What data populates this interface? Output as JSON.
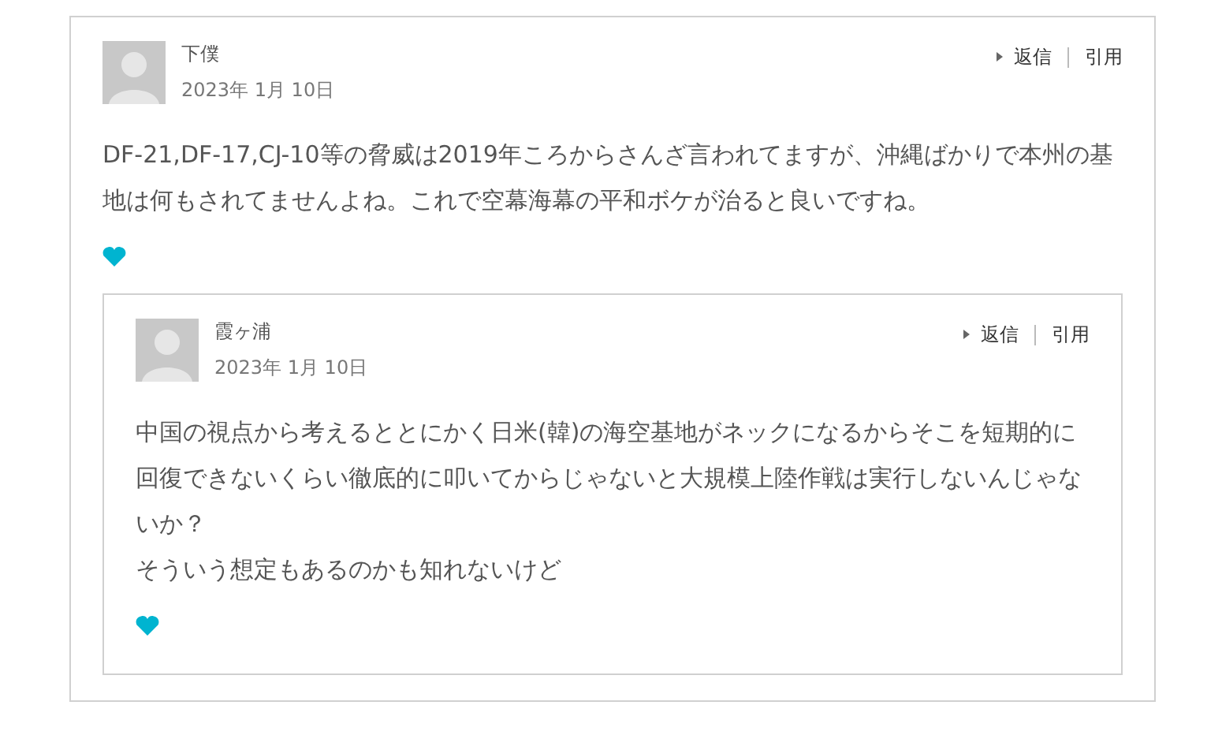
{
  "comments": [
    {
      "author": "下僕",
      "date": "2023年 1月 10日",
      "actions": [
        "返信",
        "引用"
      ],
      "body": [
        "DF-21,DF-17,CJ-10等の脅威は2019年ころからさんざ言われてますが、沖縄ばかりで本州の基地は何もされてませんよね。これで空幕海幕の平和ボケが治ると良いですね。"
      ],
      "children": [
        {
          "author": "霞ヶ浦",
          "date": "2023年 1月 10日",
          "actions": [
            "返信",
            "引用"
          ],
          "body": [
            "中国の視点から考えるととにかく日米(韓)の海空基地がネックになるからそこを短期的に回復できないくらい徹底的に叩いてからじゃないと大規模上陸作戦は実行しないんじゃないか？",
            "そういう想定もあるのかも知れないけど"
          ]
        }
      ]
    }
  ]
}
